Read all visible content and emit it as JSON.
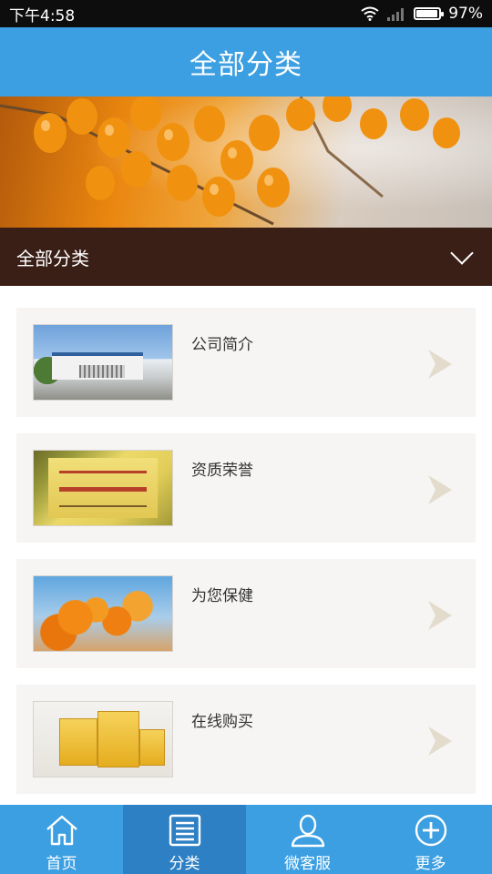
{
  "status_bar": {
    "time": "下午4:58",
    "battery_text": "97%",
    "battery_level": 0.97,
    "icons": [
      "wifi-icon",
      "signal-icon",
      "battery-icon"
    ]
  },
  "header": {
    "title": "全部分类"
  },
  "banner": {
    "image": "sea-buckthorn-berries"
  },
  "category_bar": {
    "label": "全部分类",
    "icon": "chevron-down-icon"
  },
  "list": {
    "items": [
      {
        "title": "公司简介",
        "thumb": "company-building-photo"
      },
      {
        "title": "资质荣誉",
        "thumb": "certificate-plaque-photo"
      },
      {
        "title": "为您保健",
        "thumb": "sea-buckthorn-photo"
      },
      {
        "title": "在线购买",
        "thumb": "product-box-photo"
      }
    ]
  },
  "bottom_nav": {
    "items": [
      {
        "label": "首页",
        "icon": "home-icon",
        "active": false
      },
      {
        "label": "分类",
        "icon": "list-icon",
        "active": true
      },
      {
        "label": "微客服",
        "icon": "user-icon",
        "active": false
      },
      {
        "label": "更多",
        "icon": "plus-circle-icon",
        "active": false
      }
    ]
  },
  "colors": {
    "header_blue": "#3b9fe1",
    "nav_active": "#2d80c4",
    "category_bar": "#3a1f17",
    "list_bg": "#f6f5f3",
    "arrow": "#e3dccd"
  }
}
